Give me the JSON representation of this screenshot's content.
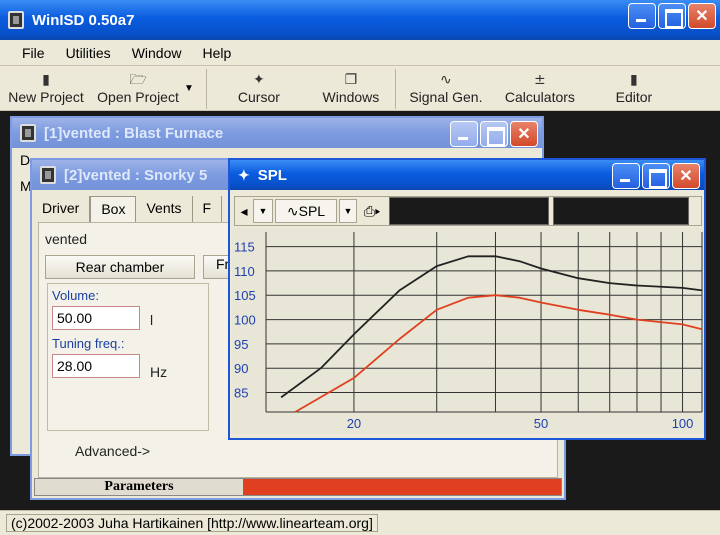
{
  "app": {
    "title": "WinISD 0.50a7",
    "menu": [
      "File",
      "Utilities",
      "Window",
      "Help"
    ],
    "toolbar": [
      {
        "label": "New Project",
        "icon": "new-project-icon"
      },
      {
        "label": "Open Project",
        "icon": "open-project-icon"
      },
      {
        "label": "Cursor",
        "icon": "cursor-icon"
      },
      {
        "label": "Windows",
        "icon": "windows-icon"
      },
      {
        "label": "Signal Gen.",
        "icon": "signal-gen-icon"
      },
      {
        "label": "Calculators",
        "icon": "calculators-icon"
      },
      {
        "label": "Editor",
        "icon": "editor-icon"
      }
    ],
    "status": "(c)2002-2003 Juha Hartikainen [http://www.linearteam.org]"
  },
  "win1": {
    "title": "[1]vented : Blast Furnace",
    "tab_fragment": "D",
    "side_fragment": "M"
  },
  "win2": {
    "title": "[2]vented : Snorky 5",
    "tabs": [
      "Driver",
      "Box",
      "Vents",
      "F"
    ],
    "box_type": "vented",
    "rear_chamber": "Rear chamber",
    "front_fragment": "Fr",
    "volume_label": "Volume:",
    "volume_value": "50.00",
    "volume_unit": "l",
    "tuning_label": "Tuning freq.:",
    "tuning_value": "28.00",
    "tuning_unit": "Hz",
    "advanced": "Advanced->",
    "parameters": "Parameters"
  },
  "spl": {
    "title": "SPL",
    "toolbar_label": "SPL",
    "colors": {
      "series1": "#222222",
      "series2": "#e04020",
      "grid": "#333333",
      "bg": "#e8e6d6",
      "axis_text": "#2040b0"
    }
  },
  "chart_data": {
    "type": "line",
    "x_scale": "log",
    "xlim": [
      13,
      110
    ],
    "ylim": [
      81,
      118
    ],
    "xticks": [
      20,
      50,
      100
    ],
    "yticks": [
      85,
      90,
      95,
      100,
      105,
      110,
      115
    ],
    "grid": true,
    "series": [
      {
        "color": "#222222",
        "points": [
          [
            14,
            84
          ],
          [
            17,
            90
          ],
          [
            20,
            97
          ],
          [
            25,
            106
          ],
          [
            30,
            111
          ],
          [
            35,
            113
          ],
          [
            40,
            113
          ],
          [
            45,
            112
          ],
          [
            50,
            110.5
          ],
          [
            60,
            108.5
          ],
          [
            70,
            107.5
          ],
          [
            80,
            107
          ],
          [
            100,
            106.5
          ],
          [
            110,
            106
          ]
        ]
      },
      {
        "color": "#e04020",
        "points": [
          [
            15,
            81
          ],
          [
            20,
            88
          ],
          [
            25,
            96
          ],
          [
            30,
            102
          ],
          [
            35,
            104.5
          ],
          [
            40,
            105
          ],
          [
            45,
            104.5
          ],
          [
            50,
            103.5
          ],
          [
            60,
            102
          ],
          [
            70,
            101
          ],
          [
            80,
            100
          ],
          [
            100,
            99
          ],
          [
            110,
            98
          ]
        ]
      }
    ]
  }
}
